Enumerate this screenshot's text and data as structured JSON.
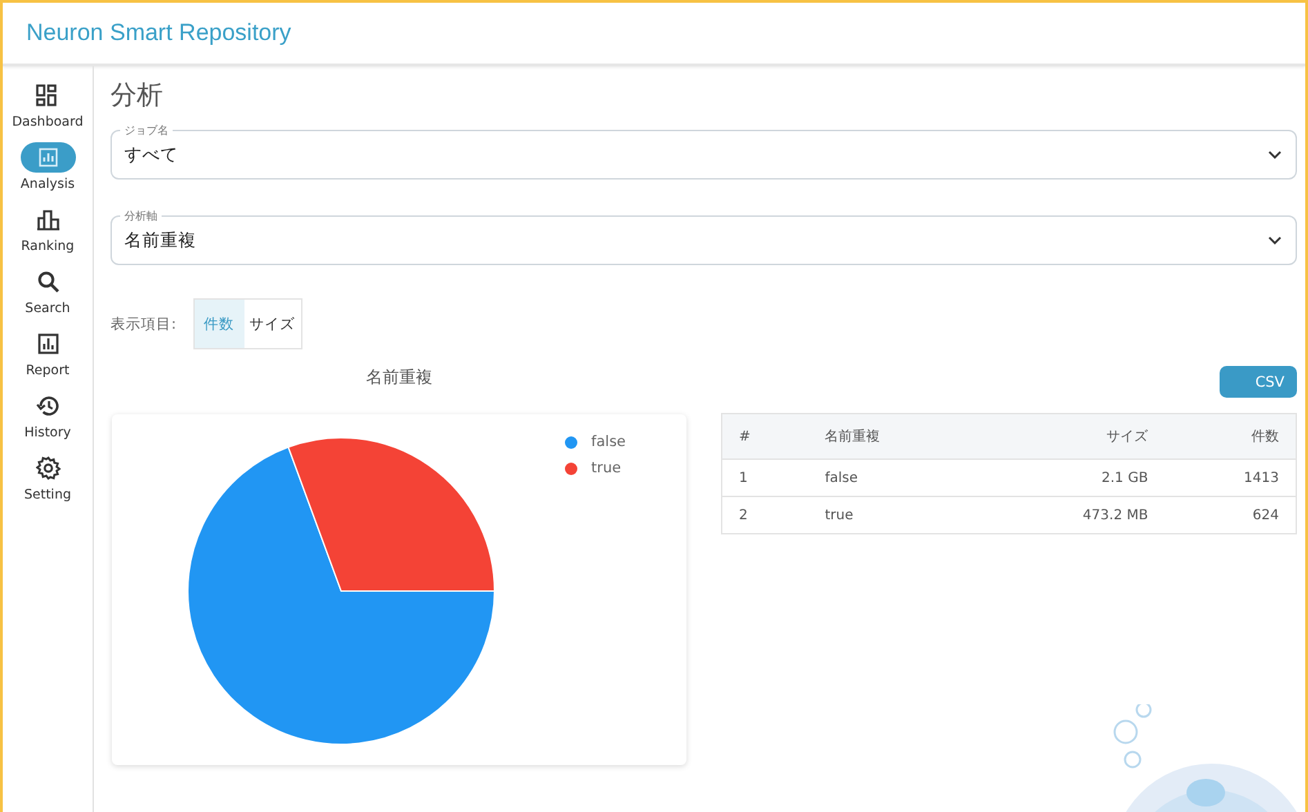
{
  "app_title": "Neuron Smart Repository",
  "sidebar": {
    "items": [
      {
        "label": "Dashboard",
        "kind": "dashboard",
        "selected": false
      },
      {
        "label": "Analysis",
        "kind": "analysis",
        "selected": true
      },
      {
        "label": "Ranking",
        "kind": "ranking",
        "selected": false
      },
      {
        "label": "Search",
        "kind": "search",
        "selected": false
      },
      {
        "label": "Report",
        "kind": "report",
        "selected": false
      },
      {
        "label": "History",
        "kind": "history",
        "selected": false
      },
      {
        "label": "Setting",
        "kind": "setting",
        "selected": false
      }
    ]
  },
  "page_title": "分析",
  "fields": [
    {
      "label": "ジョブ名",
      "value": "すべて"
    },
    {
      "label": "分析軸",
      "value": "名前重複"
    }
  ],
  "display_toggle": {
    "label": "表示項目:",
    "options": [
      {
        "label": "件数",
        "selected": true
      },
      {
        "label": "サイズ",
        "selected": false
      }
    ]
  },
  "chart_title": "名前重複",
  "chart": {
    "legend": [
      {
        "color": "#2196f3"
      },
      {
        "color": "#f44336"
      }
    ],
    "chart_data": {
      "type": "pie",
      "categories": [
        "false",
        "true"
      ],
      "values": [
        69.4,
        30.6
      ]
    }
  },
  "csv_button": "CSV",
  "table": {
    "columns": [
      "#",
      "名前重複",
      "サイズ",
      "件数"
    ],
    "rows": [
      [
        "1",
        "false",
        "2.1 GB",
        "1413"
      ],
      [
        "2",
        "true",
        "473.2 MB",
        "624"
      ]
    ]
  }
}
